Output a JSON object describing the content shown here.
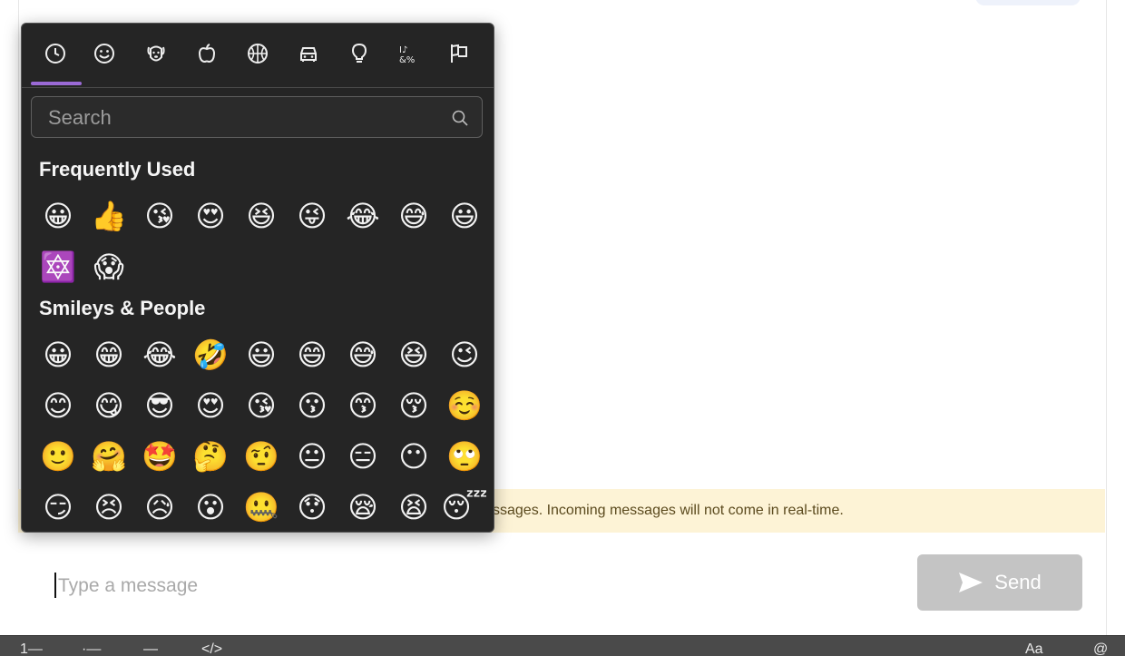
{
  "emoji_picker": {
    "categories": [
      {
        "name": "clock-icon"
      },
      {
        "name": "smiley-icon"
      },
      {
        "name": "dog-icon"
      },
      {
        "name": "apple-icon"
      },
      {
        "name": "basketball-icon"
      },
      {
        "name": "car-icon"
      },
      {
        "name": "lightbulb-icon"
      },
      {
        "name": "symbols-icon"
      },
      {
        "name": "flags-icon"
      }
    ],
    "search": {
      "placeholder": "Search"
    },
    "sections": [
      {
        "title": "Frequently Used",
        "emojis": [
          "😀",
          "👍",
          "😘",
          "😍",
          "😆",
          "😜",
          "😂",
          "😅",
          "😃",
          "🔯",
          "😱"
        ]
      },
      {
        "title": "Smileys & People",
        "emojis": [
          "😀",
          "😁",
          "😂",
          "🤣",
          "😃",
          "😄",
          "😅",
          "😆",
          "😉",
          "😊",
          "😋",
          "😎",
          "😍",
          "😘",
          "😗",
          "😙",
          "😚",
          "☺️",
          "🙂",
          "🤗",
          "🤩",
          "🤔",
          "🤨",
          "😐",
          "😑",
          "😶",
          "🙄",
          "😏",
          "😣",
          "😥",
          "😮",
          "🤐",
          "😯",
          "😪",
          "😫",
          "😴"
        ]
      }
    ]
  },
  "notice": {
    "text": "ssages. Incoming messages will not come in real-time."
  },
  "composer": {
    "placeholder": "Type a message",
    "send_label": "Send"
  },
  "toolbar": {
    "items": [
      "1—",
      "·—",
      "—",
      "</>",
      "Aa",
      "@"
    ]
  },
  "colors": {
    "picker_bg": "#252525",
    "accent": "#9b6ad6",
    "notice_bg": "#fdf3d6",
    "send_disabled": "#c4c4c4"
  }
}
